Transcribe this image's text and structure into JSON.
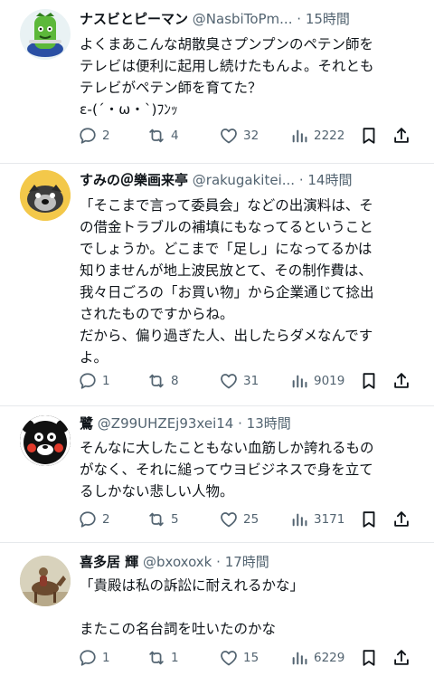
{
  "tweets": [
    {
      "name": "ナスビとピーマン",
      "handle": "@NasbiToPm...",
      "sep": "·",
      "time": "15時間",
      "text": "よくまあこんな胡散臭さプンプンのペテン師を\nテレビは便利に起用し続けたもんよ。それとも\nテレビがペテン師を育てた？\nε-(´・ω・`)ﾌﾝｯ",
      "replies": "2",
      "retweets": "4",
      "likes": "32",
      "views": "2222"
    },
    {
      "name": "すみの＠樂画来亭",
      "handle": "@rakugakitei...",
      "sep": "·",
      "time": "14時間",
      "text": "「そこまで言って委員会」などの出演料は、そ\nの借金トラブルの補填にもなってるということ\nでしょうか。どこまで「足し」になってるかは\n知りませんが地上波民放とて、その制作費は、\n我々日ごろの「お買い物」から企業通じて捻出\nされたものですからね。\nだから、偏り過ぎた人、出したらダメなんです\nよ。",
      "replies": "1",
      "retweets": "8",
      "likes": "31",
      "views": "9019"
    },
    {
      "name": "鷺",
      "handle": "@Z99UHZEj93xei14",
      "sep": "·",
      "time": "13時間",
      "text": "そんなに大したこともない血筋しか誇れるもの\nがなく、それに縋ってウヨビジネスで身を立て\nるしかない悲しい人物。",
      "replies": "2",
      "retweets": "5",
      "likes": "25",
      "views": "3171"
    },
    {
      "name": "喜多居 輝",
      "handle": "@bxoxoxk",
      "sep": "·",
      "time": "17時間",
      "text": "「貴殿は私の訴訟に耐えれるかな」\n\nまたこの名台詞を吐いたのかな",
      "replies": "1",
      "retweets": "1",
      "likes": "15",
      "views": "6229"
    }
  ],
  "colors": {
    "text": "#0f1419",
    "secondary": "#536471",
    "divider": "#e6e9ec"
  }
}
